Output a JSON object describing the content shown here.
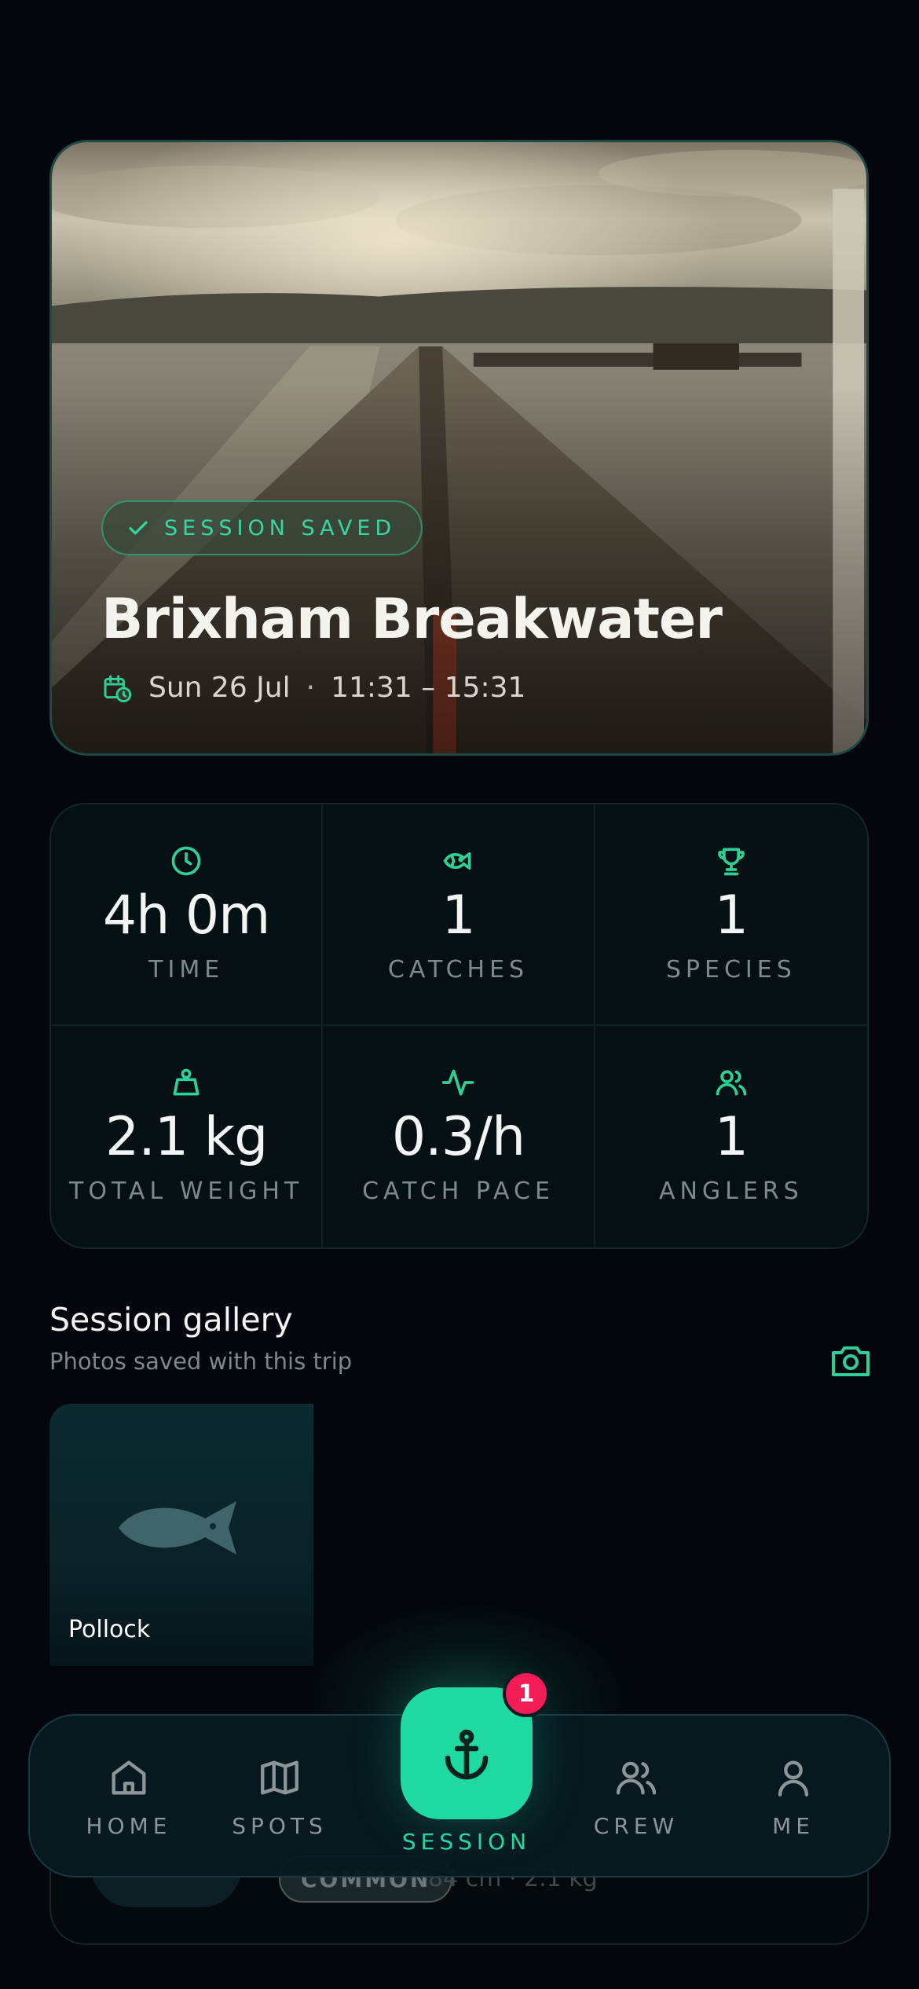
{
  "hero": {
    "status_badge": "SESSION SAVED",
    "title": "Brixham Breakwater",
    "date": "Sun 26 Jul",
    "separator": "·",
    "time_range": "11:31 – 15:31"
  },
  "stats": [
    {
      "icon": "clock-icon",
      "value": "4h 0m",
      "label": "TIME"
    },
    {
      "icon": "fish-icon",
      "value": "1",
      "label": "CATCHES"
    },
    {
      "icon": "trophy-icon",
      "value": "1",
      "label": "SPECIES"
    },
    {
      "icon": "weight-icon",
      "value": "2.1 kg",
      "label": "TOTAL WEIGHT"
    },
    {
      "icon": "activity-icon",
      "value": "0.3/h",
      "label": "CATCH PACE"
    },
    {
      "icon": "users-icon",
      "value": "1",
      "label": "ANGLERS"
    }
  ],
  "gallery": {
    "title": "Session gallery",
    "subtitle": "Photos saved with this trip",
    "photos": [
      {
        "caption": "Pollock",
        "icon": "fish-silhouette-icon"
      }
    ]
  },
  "catch_card": {
    "badge": "COMMON",
    "meta": "84 cm · 2.1 kg"
  },
  "nav": {
    "items": [
      {
        "label": "HOME",
        "icon": "home-icon"
      },
      {
        "label": "SPOTS",
        "icon": "map-icon"
      },
      {
        "label": "SESSION",
        "icon": "anchor-icon",
        "active": true
      },
      {
        "label": "CREW",
        "icon": "users-icon"
      },
      {
        "label": "ME",
        "icon": "user-icon"
      }
    ],
    "session_badge": "1"
  },
  "colors": {
    "accent": "#1fd9a2",
    "background": "#03070d",
    "badge": "#f21d57"
  }
}
